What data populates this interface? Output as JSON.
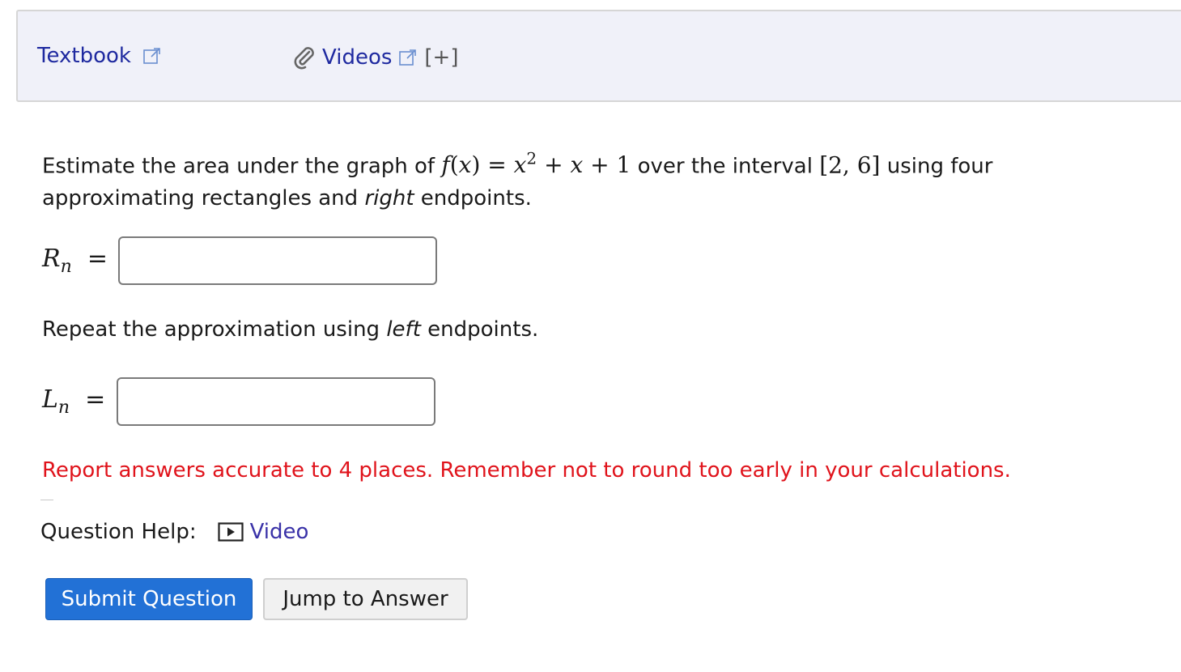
{
  "resources": {
    "textbook_label": "Textbook",
    "videos_label": "Videos",
    "expand_label": "[+]"
  },
  "question": {
    "text_before": "Estimate the area under the graph of ",
    "function_name": "f",
    "function_arg": "x",
    "expr_x": "x",
    "expr_exp": "2",
    "expr_rest_op1": "+",
    "expr_x2": "x",
    "expr_rest_op2": "+",
    "expr_const": "1",
    "text_middle": " over the interval ",
    "interval": "[2, 6]",
    "text_after_1": " using four approximating rectangles and ",
    "emphasis_1": "right",
    "text_after_2": " endpoints."
  },
  "answers": {
    "right_label_main": "R",
    "right_label_sub": "n",
    "right_value": "",
    "left_label_main": "L",
    "left_label_sub": "n",
    "left_value": ""
  },
  "repeat": {
    "text_before": "Repeat the approximation using ",
    "emphasis": "left",
    "text_after": " endpoints."
  },
  "warning": "Report answers accurate to 4 places. Remember not to round too early in your calculations.",
  "help": {
    "label": "Question Help:",
    "video_label": "Video"
  },
  "buttons": {
    "submit": "Submit Question",
    "jump": "Jump to Answer"
  },
  "colors": {
    "link": "#1f2aa0",
    "warning": "#e0131b",
    "submit_bg": "#2271d6",
    "panel_bg": "#f0f1f9"
  }
}
